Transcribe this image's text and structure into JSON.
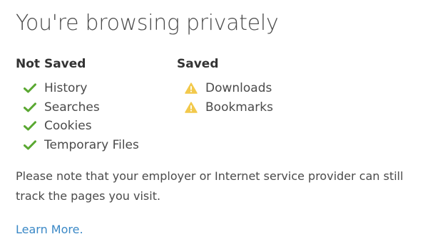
{
  "title": "You're browsing privately",
  "not_saved": {
    "heading": "Not Saved",
    "items": [
      {
        "label": "History",
        "icon": "check-icon"
      },
      {
        "label": "Searches",
        "icon": "check-icon"
      },
      {
        "label": "Cookies",
        "icon": "check-icon"
      },
      {
        "label": "Temporary Files",
        "icon": "check-icon"
      }
    ]
  },
  "saved": {
    "heading": "Saved",
    "items": [
      {
        "label": "Downloads",
        "icon": "warning-icon"
      },
      {
        "label": "Bookmarks",
        "icon": "warning-icon"
      }
    ]
  },
  "note": "Please note that your employer or Internet service provider can still track the pages you visit.",
  "learn_more": "Learn More.",
  "colors": {
    "check": "#5aa832",
    "warning": "#f2c94c",
    "link": "#3a88c6",
    "text": "#4a4a4a"
  }
}
